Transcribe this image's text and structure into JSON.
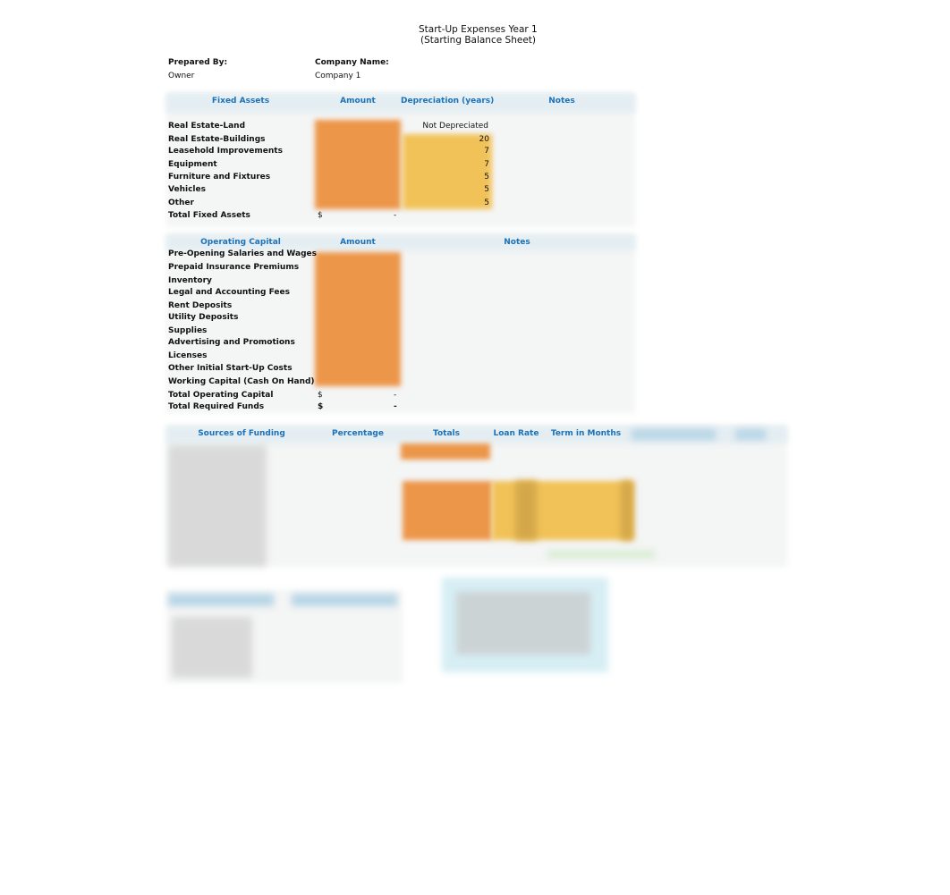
{
  "document": {
    "title_line1": "Start-Up Expenses Year 1",
    "title_line2": "(Starting Balance Sheet)"
  },
  "meta": {
    "prepared_by_label": "Prepared By:",
    "prepared_by_value": "Owner",
    "company_name_label": "Company Name:",
    "company_name_value": "Company 1"
  },
  "fixed_assets": {
    "headers": [
      "Fixed Assets",
      "Amount",
      "Depreciation (years)",
      "Notes"
    ],
    "rows": [
      {
        "label": "Real Estate-Land",
        "depreciation": "Not Depreciated"
      },
      {
        "label": "Real Estate-Buildings",
        "depreciation": "20"
      },
      {
        "label": "Leasehold Improvements",
        "depreciation": "7"
      },
      {
        "label": "Equipment",
        "depreciation": "7"
      },
      {
        "label": "Furniture and Fixtures",
        "depreciation": "5"
      },
      {
        "label": "Vehicles",
        "depreciation": "5"
      },
      {
        "label": "Other",
        "depreciation": "5"
      }
    ],
    "total": {
      "label": "Total Fixed Assets",
      "currency": "$",
      "value": "-"
    }
  },
  "operating_capital": {
    "headers": [
      "Operating Capital",
      "Amount",
      "Notes"
    ],
    "rows": [
      "Pre-Opening Salaries and Wages",
      "Prepaid Insurance Premiums",
      "Inventory",
      "Legal and Accounting Fees",
      "Rent Deposits",
      "Utility Deposits",
      "Supplies",
      "Advertising and Promotions",
      "Licenses",
      "Other Initial Start-Up Costs",
      "Working Capital (Cash On Hand)"
    ],
    "total": {
      "label": "Total Operating Capital",
      "currency": "$",
      "value": "-"
    },
    "grand_total": {
      "label": "Total Required Funds",
      "currency": "$",
      "value": "-"
    }
  },
  "funding": {
    "headers": [
      "Sources of Funding",
      "Percentage",
      "Totals",
      "Loan Rate",
      "Term in Months"
    ]
  },
  "colors": {
    "header_text": "#1b72b8",
    "input_orange": "#ec9649",
    "input_yellow": "#f1c258",
    "header_band": "#e4eef2"
  }
}
